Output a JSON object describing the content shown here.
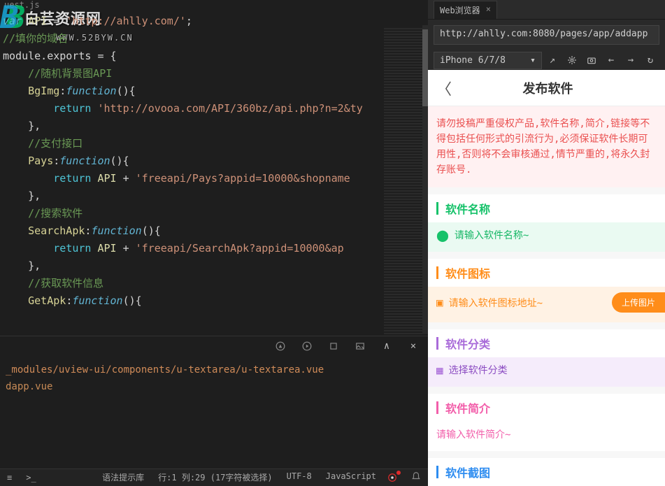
{
  "editor": {
    "tab": "uest.js",
    "watermark_title": "白芸资源网",
    "watermark_url": "WWW.52BYW.CN",
    "code": {
      "l1_var": "var",
      "l1_ident": "API",
      "l1_eq": " = ",
      "l1_str": "'http://ahlly.com/'",
      "l1_end": ";",
      "l2": "//填你的域名",
      "l3a": "module.exports = {",
      "l4": "//随机背景图API",
      "l5_name": "BgImg",
      "l5_func": "function",
      "l5_paren": "(){",
      "l6_ret": "return",
      "l6_str": "'http://ovooa.com/API/360bz/api.php?n=2&ty",
      "l7": "},",
      "l8": "//支付接口",
      "l9_name": "Pays",
      "l10_str": "'freeapi/Pays?appid=10000&shopname",
      "l12": "//搜索软件",
      "l13_name": "SearchApk",
      "l14_str": "'freeapi/SearchApk?appid=10000&ap",
      "l16": "//获取软件信息",
      "l17_name": "GetApk"
    }
  },
  "console": {
    "l1": "_modules/uview-ui/components/u-textarea/u-textarea.vue",
    "l2": "dapp.vue"
  },
  "browser": {
    "tab_title": "Web浏览器",
    "url": "http://ahlly.com:8080/pages/app/addapp",
    "device": "iPhone 6/7/8"
  },
  "app": {
    "title": "发布软件",
    "warning": "请勿投稿严重侵权产品,软件名称,简介,链接等不得包括任何形式的引流行为,必须保证软件长期可用性,否则将不会审核通过,情节严重的,将永久封存账号.",
    "sec_name": "软件名称",
    "ph_name": "请输入软件名称~",
    "sec_icon": "软件图标",
    "ph_icon": "请输入软件图标地址~",
    "btn_upload": "上传图片",
    "sec_cat": "软件分类",
    "ph_cat": "选择软件分类",
    "sec_desc": "软件简介",
    "ph_desc": "请输入软件简介~",
    "sec_shot": "软件截图"
  },
  "status": {
    "hint": "语法提示库",
    "pos": "行:1 列:29 (17字符被选择)",
    "encoding": "UTF-8",
    "lang": "JavaScript"
  }
}
